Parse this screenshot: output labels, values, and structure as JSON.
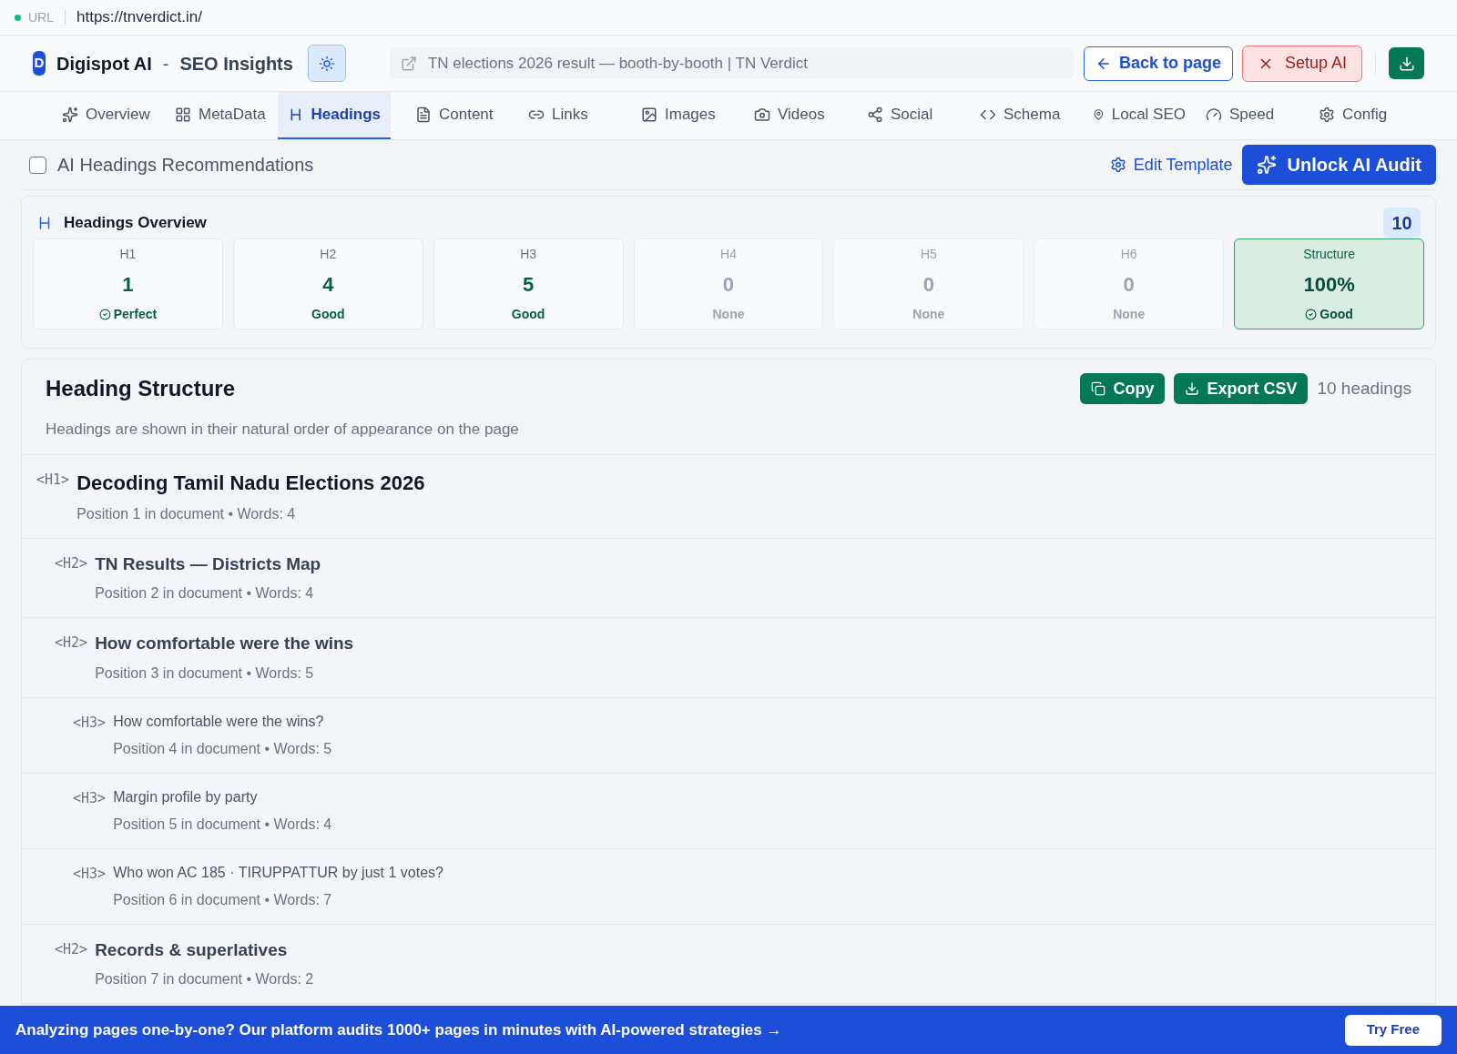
{
  "url_bar": {
    "label": "URL",
    "value": "https://tnverdict.in/"
  },
  "header": {
    "logo_letter": "D",
    "brand": "Digispot AI",
    "separator": "-",
    "product": "SEO Insights",
    "page_title": "TN elections 2026 result — booth-by-booth | TN Verdict",
    "back_button": "Back to page",
    "setup_button": "Setup AI"
  },
  "tabs": [
    {
      "label": "Overview",
      "selected": false
    },
    {
      "label": "MetaData",
      "selected": false
    },
    {
      "label": "Headings",
      "selected": true
    },
    {
      "label": "Content",
      "selected": false
    },
    {
      "label": "Links",
      "selected": false
    },
    {
      "label": "Images",
      "selected": false
    },
    {
      "label": "Videos",
      "selected": false
    },
    {
      "label": "Social",
      "selected": false
    },
    {
      "label": "Schema",
      "selected": false
    },
    {
      "label": "Local SEO",
      "selected": false
    },
    {
      "label": "Speed",
      "selected": false
    },
    {
      "label": "Config",
      "selected": false
    }
  ],
  "toolbar": {
    "recommendations": {
      "label": "AI Headings Recommendations",
      "checked": false
    },
    "edit_template": "Edit Template",
    "unlock": "Unlock AI Audit"
  },
  "overview": {
    "title": "Headings Overview",
    "total": "10",
    "cards": [
      {
        "label": "H1",
        "value": "1",
        "status": "Perfect",
        "kind": "count",
        "verified": true
      },
      {
        "label": "H2",
        "value": "4",
        "status": "Good",
        "kind": "count",
        "verified": false
      },
      {
        "label": "H3",
        "value": "5",
        "status": "Good",
        "kind": "count",
        "verified": false
      },
      {
        "label": "H4",
        "value": "0",
        "status": "None",
        "kind": "empty",
        "verified": false
      },
      {
        "label": "H5",
        "value": "0",
        "status": "None",
        "kind": "empty",
        "verified": false
      },
      {
        "label": "H6",
        "value": "0",
        "status": "None",
        "kind": "empty",
        "verified": false
      },
      {
        "label": "Structure",
        "value": "100%",
        "status": "Good",
        "kind": "summary",
        "verified": true
      }
    ]
  },
  "structure": {
    "title": "Heading Structure",
    "copy": "Copy",
    "export": "Export CSV",
    "count": "10 headings",
    "description": "Headings are shown in their natural order of appearance on the page",
    "headings": [
      {
        "tag": "<H1>",
        "text": "Decoding Tamil Nadu Elections 2026",
        "meta": "Position 1 in document • Words: 4",
        "children": [
          {
            "tag": "<H2>",
            "text": "TN Results — Districts Map",
            "meta": "Position 2 in document • Words: 4"
          },
          {
            "tag": "<H2>",
            "text": "How comfortable were the wins",
            "meta": "Position 3 in document • Words: 5",
            "children": [
              {
                "tag": "<H3>",
                "text": "How comfortable were the wins?",
                "meta": "Position 4 in document • Words: 5"
              },
              {
                "tag": "<H3>",
                "text": "Margin profile by party",
                "meta": "Position 5 in document • Words: 4"
              },
              {
                "tag": "<H3>",
                "text": "Who won AC 185 · TIRUPPATTUR by just 1 votes?",
                "meta": "Position 6 in document • Words: 7"
              }
            ]
          },
          {
            "tag": "<H2>",
            "text": "Records & superlatives",
            "meta": "Position 7 in document • Words: 2"
          }
        ]
      }
    ]
  },
  "banner": {
    "text": "Analyzing pages one-by-one? Our platform audits 1000+ pages in minutes with AI-powered strategies →",
    "button": "Try Free"
  }
}
